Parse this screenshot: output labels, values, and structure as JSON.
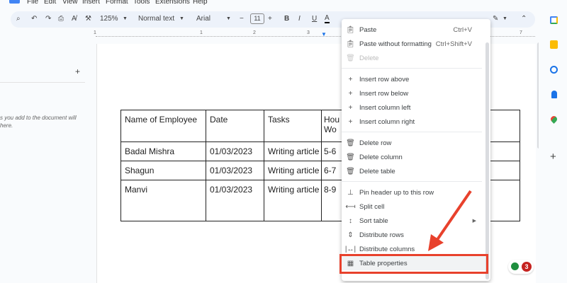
{
  "menubar": [
    "File",
    "Edit",
    "View",
    "Insert",
    "Format",
    "Tools",
    "Extensions",
    "Help"
  ],
  "toolbar": {
    "zoom": "125%",
    "style": "Normal text",
    "font": "Arial",
    "font_size": "11",
    "bold": "B",
    "italic": "I",
    "underline": "U",
    "text_color": "A"
  },
  "ruler": [
    "1",
    "1",
    "2",
    "3",
    "7"
  ],
  "left_panel": {
    "add": "+",
    "hint_line1": "s you add to the document will",
    "hint_line2": "here."
  },
  "table": {
    "header": [
      "Name of Employee",
      "Date",
      "Tasks",
      "Hou Wo"
    ],
    "rows": [
      [
        "Badal Mishra",
        "01/03/2023",
        "Writing article",
        "5-6"
      ],
      [
        "Shagun",
        "01/03/2023",
        "Writing article",
        "6-7"
      ],
      [
        "Manvi",
        "01/03/2023",
        "Writing article",
        "8-9"
      ]
    ]
  },
  "context_menu": {
    "paste": {
      "label": "Paste",
      "shortcut": "Ctrl+V"
    },
    "paste_plain": {
      "label": "Paste without formatting",
      "shortcut": "Ctrl+Shift+V"
    },
    "delete": "Delete",
    "insert_row_above": "Insert row above",
    "insert_row_below": "Insert row below",
    "insert_col_left": "Insert column left",
    "insert_col_right": "Insert column right",
    "delete_row": "Delete row",
    "delete_column": "Delete column",
    "delete_table": "Delete table",
    "pin_header": "Pin header up to this row",
    "split_cell": "Split cell",
    "sort_table": "Sort table",
    "distribute_rows": "Distribute rows",
    "distribute_columns": "Distribute columns",
    "table_properties": "Table properties"
  },
  "badge": {
    "count": "3"
  },
  "colors": {
    "highlight": "#e8412c",
    "accent": "#1a73e8"
  }
}
